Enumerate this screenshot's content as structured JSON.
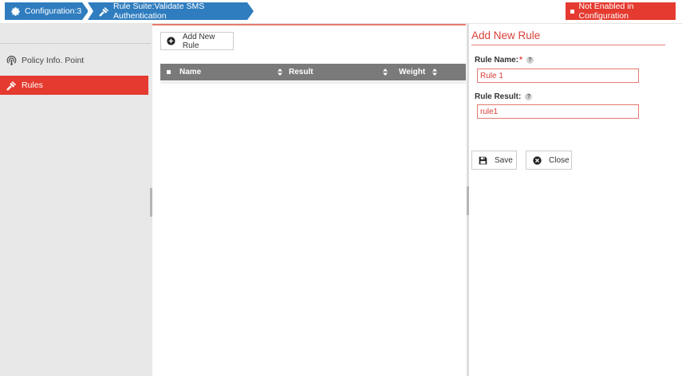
{
  "breadcrumb": {
    "items": [
      {
        "label": "Configuration:3",
        "icon": "gear-icon"
      },
      {
        "label": "Rule Suite:Validate SMS Authentication",
        "icon": "gavel-icon"
      }
    ]
  },
  "status": {
    "label": "Not Enabled in Configuration",
    "color": "#e53a2f"
  },
  "sidebar": {
    "items": [
      {
        "label": "Policy Info. Point",
        "icon": "broadcast-icon"
      },
      {
        "label": "Rules",
        "icon": "gavel-icon",
        "active": true
      }
    ]
  },
  "toolbar": {
    "add_rule_label": "Add New Rule"
  },
  "table": {
    "columns": [
      "Name",
      "Result",
      "Weight"
    ],
    "rows": []
  },
  "form": {
    "title": "Add New Rule",
    "rule_name_label": "Rule Name:",
    "required_mark": "*",
    "help_glyph": "?",
    "rule_name_value": "Rule 1",
    "rule_result_label": "Rule Result:",
    "rule_result_value": "rule1",
    "save_label": "Save",
    "close_label": "Close"
  },
  "colors": {
    "accent": "#e53a2f",
    "breadcrumb": "#2f7dbf",
    "table_header": "#7a7a7a"
  }
}
